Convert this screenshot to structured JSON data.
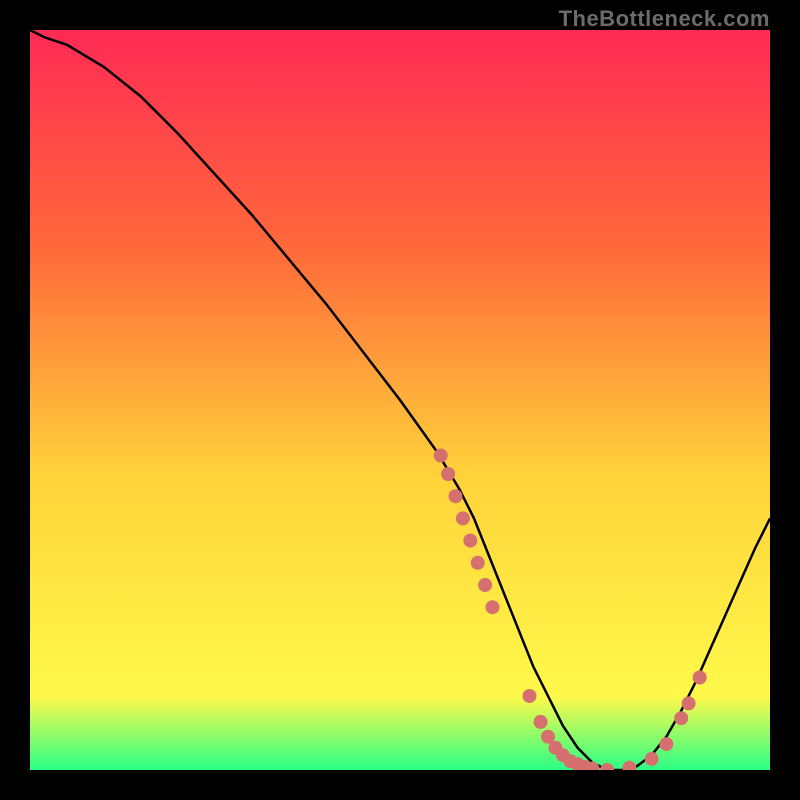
{
  "watermark": "TheBottleneck.com",
  "chart_data": {
    "type": "line",
    "title": "",
    "xlabel": "",
    "ylabel": "",
    "xlim": [
      0,
      100
    ],
    "ylim": [
      0,
      100
    ],
    "background_gradient": {
      "top": "#ff2a55",
      "mid1": "#ff6a3a",
      "mid2": "#ffd23a",
      "mid3": "#fff94a",
      "bottom": "#2aff85"
    },
    "series": [
      {
        "name": "curve",
        "x": [
          0,
          2,
          5,
          10,
          15,
          20,
          25,
          30,
          35,
          40,
          45,
          50,
          55,
          58,
          60,
          62,
          64,
          66,
          68,
          70,
          72,
          74,
          76,
          78,
          80,
          82,
          84,
          86,
          88,
          90,
          92,
          94,
          96,
          98,
          100
        ],
        "y": [
          100,
          99,
          98,
          95,
          91,
          86,
          80.5,
          75,
          69,
          63,
          56.5,
          50,
          43,
          38,
          34,
          29,
          24,
          19,
          14,
          10,
          6,
          3,
          1,
          0,
          0,
          0.5,
          2,
          4.5,
          8,
          12,
          16.5,
          21,
          25.5,
          30,
          34
        ]
      }
    ],
    "scatter_points": [
      {
        "x": 55.5,
        "y": 42.5
      },
      {
        "x": 56.5,
        "y": 40
      },
      {
        "x": 57.5,
        "y": 37
      },
      {
        "x": 58.5,
        "y": 34
      },
      {
        "x": 59.5,
        "y": 31
      },
      {
        "x": 60.5,
        "y": 28
      },
      {
        "x": 61.5,
        "y": 25
      },
      {
        "x": 62.5,
        "y": 22
      },
      {
        "x": 67.5,
        "y": 10
      },
      {
        "x": 69,
        "y": 6.5
      },
      {
        "x": 70,
        "y": 4.5
      },
      {
        "x": 71,
        "y": 3
      },
      {
        "x": 72,
        "y": 2
      },
      {
        "x": 73,
        "y": 1.2
      },
      {
        "x": 74,
        "y": 0.8
      },
      {
        "x": 75,
        "y": 0.4
      },
      {
        "x": 76,
        "y": 0.2
      },
      {
        "x": 78,
        "y": 0
      },
      {
        "x": 81,
        "y": 0.3
      },
      {
        "x": 84,
        "y": 1.5
      },
      {
        "x": 86,
        "y": 3.5
      },
      {
        "x": 88,
        "y": 7
      },
      {
        "x": 89,
        "y": 9
      },
      {
        "x": 90.5,
        "y": 12.5
      }
    ]
  }
}
